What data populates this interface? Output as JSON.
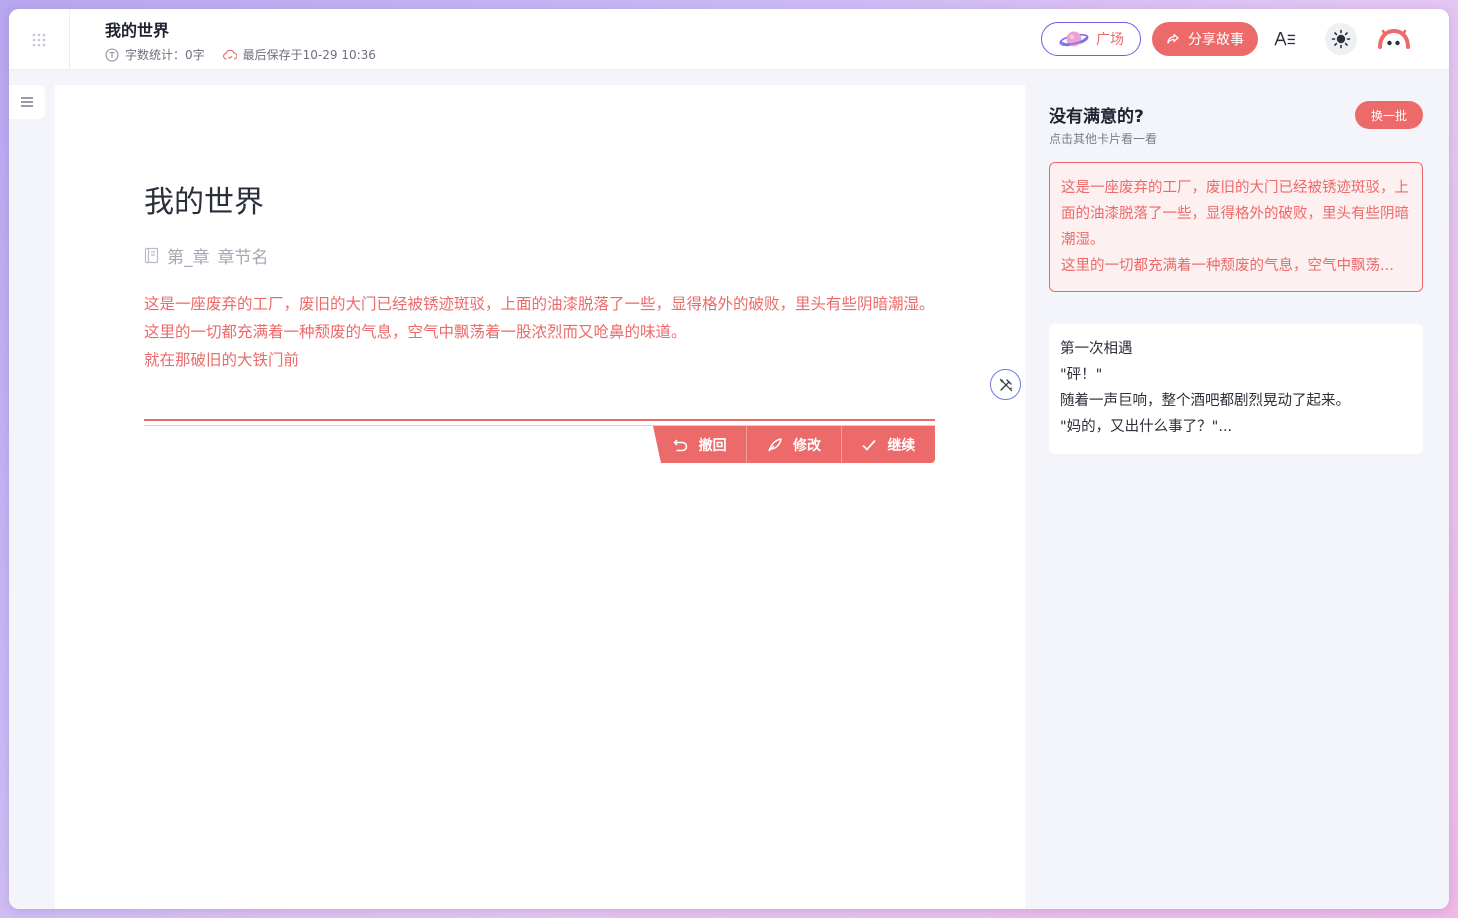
{
  "header": {
    "title": "我的世界",
    "word_count": "字数统计：0字",
    "last_saved": "最后保存于10-29 10:36",
    "plaza_label": "广场",
    "share_label": "分享故事",
    "font_label": "A☰"
  },
  "editor": {
    "title": "我的世界",
    "chapter_number": "第_章",
    "chapter_name": "章节名",
    "paragraphs": [
      "这是一座废弃的工厂，废旧的大门已经被锈迹斑驳，上面的油漆脱落了一些，显得格外的破败，里头有些阴暗潮湿。",
      "这里的一切都充满着一种颓废的气息，空气中飘荡着一股浓烈而又呛鼻的味道。",
      "就在那破旧的大铁门前"
    ],
    "actions": {
      "undo": "撤回",
      "edit": "修改",
      "continue": "继续"
    }
  },
  "panel": {
    "title": "没有满意的?",
    "subtitle": "点击其他卡片看一看",
    "refresh_label": "换一批",
    "cards": [
      {
        "lines": [
          "这是一座废弃的工厂，废旧的大门已经被锈迹斑驳，上面的油漆脱落了一些，显得格外的破败，里头有些阴暗潮湿。",
          "这里的一切都充满着一种颓废的气息，空气中飘荡..."
        ]
      },
      {
        "lines": [
          "第一次相遇",
          "\"砰！\"",
          "随着一声巨响，整个酒吧都剧烈晃动了起来。",
          "\"妈的，又出什么事了？\"..."
        ]
      }
    ]
  },
  "colors": {
    "accent": "#ec6a6a",
    "purple": "#6c5ce7"
  }
}
